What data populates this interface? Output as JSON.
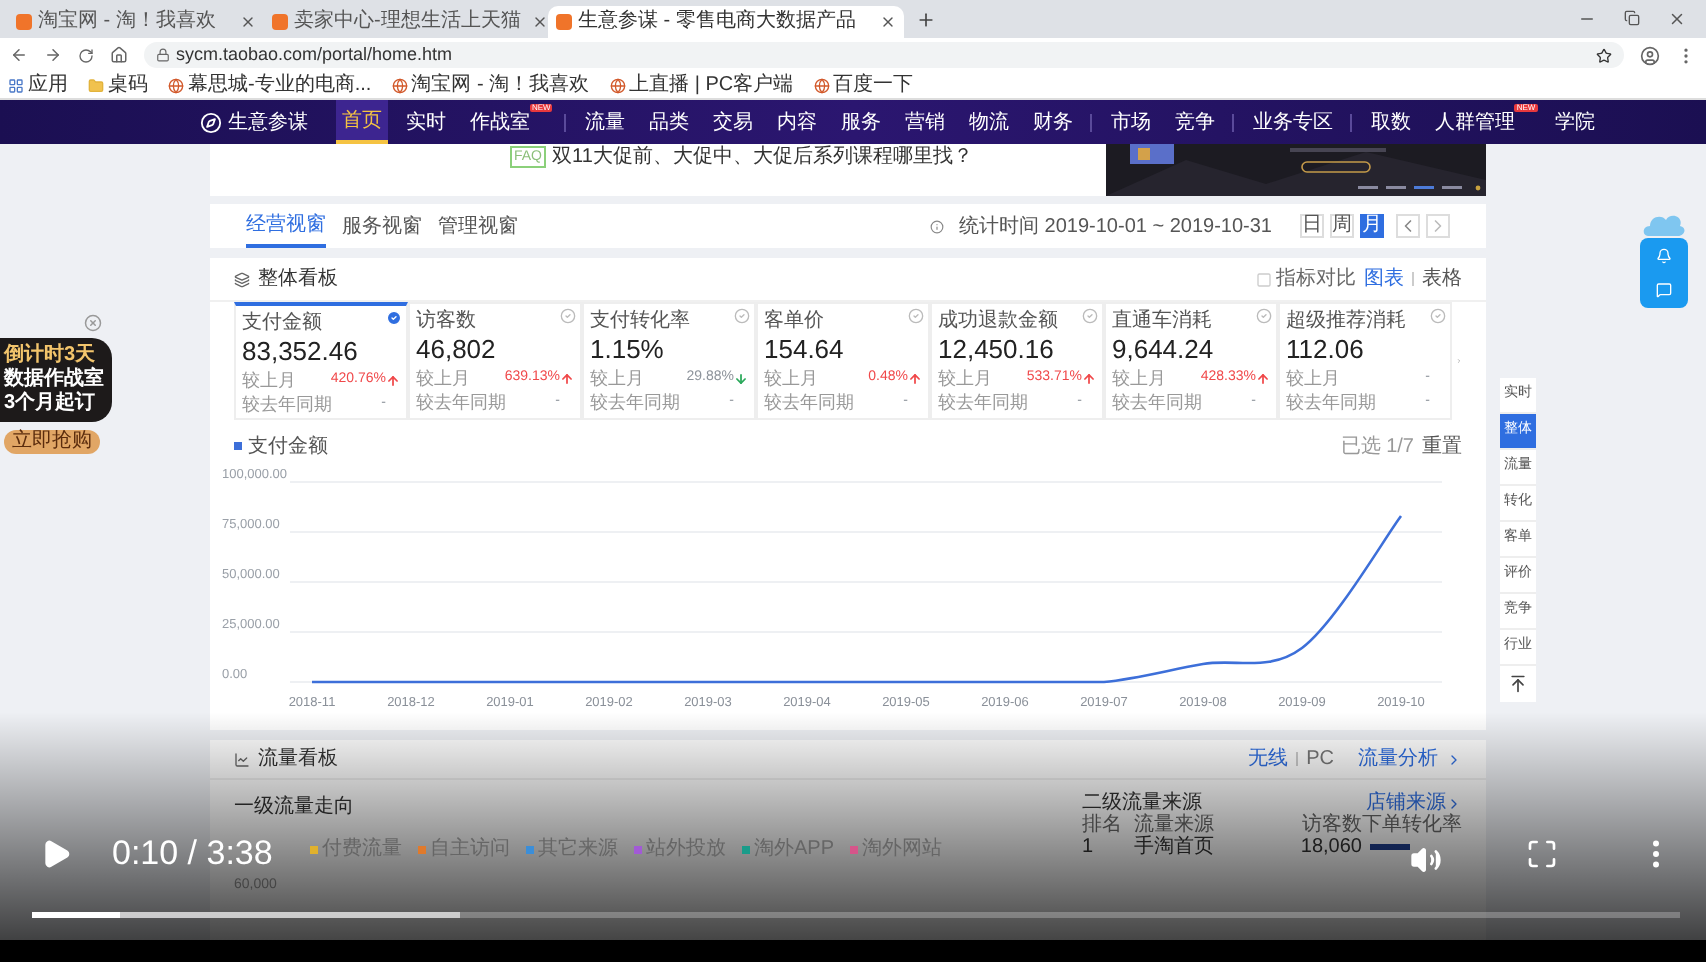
{
  "browser": {
    "tabs": [
      {
        "title": "淘宝网 - 淘！我喜欢",
        "selected": false
      },
      {
        "title": "卖家中心-理想生活上天猫",
        "selected": false
      },
      {
        "title": "生意参谋 - 零售电商大数据产品",
        "selected": true
      }
    ],
    "address": "sycm.taobao.com/portal/home.htm",
    "bookmarks": [
      {
        "label": "应用",
        "kind": "apps"
      },
      {
        "label": "桌码",
        "kind": "folder"
      },
      {
        "label": "幕思城-专业的电商...",
        "kind": "site"
      },
      {
        "label": "淘宝网 - 淘！我喜欢",
        "kind": "site"
      },
      {
        "label": "上直播 | PC客户端",
        "kind": "site"
      },
      {
        "label": "百度一下",
        "kind": "site"
      }
    ]
  },
  "nav": {
    "brand": "生意参谋",
    "groups": [
      [
        {
          "label": "首页",
          "selected": true
        },
        {
          "label": "实时",
          "selected": false
        },
        {
          "label": "作战室",
          "selected": false,
          "badge": "NEW"
        }
      ],
      [
        {
          "label": "流量",
          "selected": false
        },
        {
          "label": "品类",
          "selected": false
        },
        {
          "label": "交易",
          "selected": false
        },
        {
          "label": "内容",
          "selected": false
        },
        {
          "label": "服务",
          "selected": false
        },
        {
          "label": "营销",
          "selected": false
        },
        {
          "label": "物流",
          "selected": false
        },
        {
          "label": "财务",
          "selected": false
        }
      ],
      [
        {
          "label": "市场",
          "selected": false
        },
        {
          "label": "竞争",
          "selected": false
        }
      ],
      [
        {
          "label": "业务专区",
          "selected": false
        }
      ],
      [
        {
          "label": "取数",
          "selected": false
        },
        {
          "label": "人群管理",
          "selected": false,
          "badge": "NEW"
        },
        {
          "label": "学院",
          "selected": false
        }
      ]
    ]
  },
  "notice": {
    "tag": "FAQ",
    "text": "双11大促前、大促中、大促后系列课程哪里找？"
  },
  "ad": {
    "lines": [
      "倒计时3天",
      "数据作战室",
      "3个月起订"
    ],
    "button": "立即抢购"
  },
  "view_tabs": [
    {
      "label": "经营视窗",
      "selected": true
    },
    {
      "label": "服务视窗",
      "selected": false
    },
    {
      "label": "管理视窗",
      "selected": false
    }
  ],
  "stat_time": "统计时间 2019-10-01 ~ 2019-10-31",
  "periods": [
    {
      "label": "日",
      "selected": false
    },
    {
      "label": "周",
      "selected": false
    },
    {
      "label": "月",
      "selected": true
    }
  ],
  "overview": {
    "title": "整体看板",
    "compare": {
      "label": "指标对比",
      "checked": false
    },
    "views": [
      {
        "label": "图表",
        "selected": true
      },
      {
        "label": "表格",
        "selected": false
      }
    ],
    "metrics": [
      {
        "label": "支付金额",
        "value": "83,352.46",
        "selected": true,
        "rows": [
          {
            "label": "较上月",
            "value": "420.76%",
            "kind": "up"
          },
          {
            "label": "较去年同期",
            "value": "-",
            "kind": "none"
          }
        ]
      },
      {
        "label": "访客数",
        "value": "46,802",
        "selected": false,
        "rows": [
          {
            "label": "较上月",
            "value": "639.13%",
            "kind": "up"
          },
          {
            "label": "较去年同期",
            "value": "-",
            "kind": "none"
          }
        ]
      },
      {
        "label": "支付转化率",
        "value": "1.15%",
        "selected": false,
        "rows": [
          {
            "label": "较上月",
            "value": "29.88%",
            "kind": "down"
          },
          {
            "label": "较去年同期",
            "value": "-",
            "kind": "none"
          }
        ]
      },
      {
        "label": "客单价",
        "value": "154.64",
        "selected": false,
        "rows": [
          {
            "label": "较上月",
            "value": "0.48%",
            "kind": "up"
          },
          {
            "label": "较去年同期",
            "value": "-",
            "kind": "none"
          }
        ]
      },
      {
        "label": "成功退款金额",
        "value": "12,450.16",
        "selected": false,
        "rows": [
          {
            "label": "较上月",
            "value": "533.71%",
            "kind": "up"
          },
          {
            "label": "较去年同期",
            "value": "-",
            "kind": "none"
          }
        ]
      },
      {
        "label": "直通车消耗",
        "value": "9,644.24",
        "selected": false,
        "rows": [
          {
            "label": "较上月",
            "value": "428.33%",
            "kind": "up"
          },
          {
            "label": "较去年同期",
            "value": "-",
            "kind": "none"
          }
        ]
      },
      {
        "label": "超级推荐消耗",
        "value": "112.06",
        "selected": false,
        "rows": [
          {
            "label": "较上月",
            "value": "-",
            "kind": "none"
          },
          {
            "label": "较去年同期",
            "value": "-",
            "kind": "none"
          }
        ]
      }
    ],
    "selection": "已选 1/7",
    "reset": "重置",
    "chart_data": {
      "type": "line",
      "categories": [
        "2018-11",
        "2018-12",
        "2019-01",
        "2019-02",
        "2019-03",
        "2019-04",
        "2019-05",
        "2019-06",
        "2019-07",
        "2019-08",
        "2019-09",
        "2019-10"
      ],
      "series": [
        {
          "name": "支付金额",
          "color": "#3d6fd9",
          "values": [
            0,
            0,
            0,
            0,
            0,
            0,
            0,
            0,
            0,
            9000,
            17000,
            83000
          ]
        }
      ],
      "grid": true,
      "ylim": [
        0,
        100000
      ],
      "yticks": [
        {
          "value": 0,
          "label": "0.00"
        },
        {
          "value": 25000,
          "label": "25,000.00"
        },
        {
          "value": 50000,
          "label": "50,000.00"
        },
        {
          "value": 75000,
          "label": "75,000.00"
        },
        {
          "value": 100000,
          "label": "100,000.00"
        }
      ]
    }
  },
  "side_nav": [
    {
      "label": "实时",
      "selected": false
    },
    {
      "label": "整体",
      "selected": true
    },
    {
      "label": "流量",
      "selected": false
    },
    {
      "label": "转化",
      "selected": false
    },
    {
      "label": "客单",
      "selected": false
    },
    {
      "label": "评价",
      "selected": false
    },
    {
      "label": "竞争",
      "selected": false
    },
    {
      "label": "行业",
      "selected": false
    }
  ],
  "traffic": {
    "title": "流量看板",
    "terminals": [
      {
        "label": "无线",
        "selected": true
      },
      {
        "label": "PC",
        "selected": false
      }
    ],
    "analysis": "流量分析",
    "left": {
      "title": "一级流量走向",
      "legend": [
        {
          "name": "付费流量",
          "color": "#e0b12c"
        },
        {
          "name": "自主访问",
          "color": "#e07a2c"
        },
        {
          "name": "其它来源",
          "color": "#3b8ed8"
        },
        {
          "name": "站外投放",
          "color": "#a25ad6"
        },
        {
          "name": "淘外APP",
          "color": "#1a9c8a"
        },
        {
          "name": "淘外网站",
          "color": "#d6558a"
        }
      ],
      "ytick": "60,000"
    },
    "right": {
      "title": "二级流量来源",
      "link": "店铺来源",
      "columns": [
        "排名",
        "流量来源",
        "访客数",
        "下单转化率"
      ],
      "rows": [
        [
          "1",
          "手淘首页",
          "18,060"
        ]
      ]
    }
  },
  "player": {
    "time": "0:10 / 3:38",
    "progress": {
      "level": 0.053
    },
    "buffer": {
      "level": 0.26
    }
  }
}
